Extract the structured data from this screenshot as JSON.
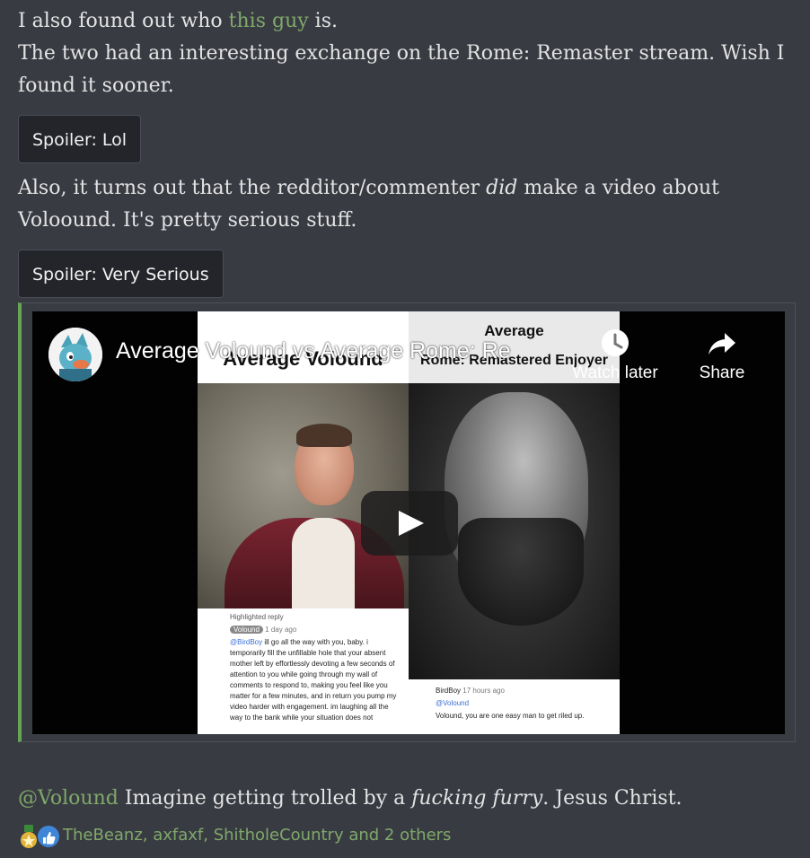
{
  "post": {
    "line1_prefix": "I also found out who ",
    "line1_link": "this guy",
    "line1_suffix": " is.",
    "line2": "The two had an interesting exchange on the Rome: Remaster stream. Wish I found it sooner.",
    "spoiler1_label": "Spoiler: Lol",
    "line3_prefix": "Also, it turns out that the redditor/commenter ",
    "line3_emph": "did",
    "line3_suffix": " make a video about Voloound. It's pretty serious stuff.",
    "spoiler2_label": "Spoiler: Very Serious",
    "mention": "@Volound",
    "closing_prefix": " Imagine getting trolled by a ",
    "closing_emph": "fucking furry",
    "closing_suffix": ". Jesus Christ."
  },
  "video": {
    "title": "Average Volound vs Average Rome: Re",
    "watch_later_label": "Watch later",
    "share_label": "Share",
    "thumbnail": {
      "left_title": "Average Volound",
      "right_title_line1": "Average",
      "right_title_line2": "Rome: Remastered Enjoyer",
      "left_comment_header": "Highlighted reply",
      "left_comment_author": "Volound",
      "left_comment_time": "1 day ago",
      "left_comment_mention": "@BirdBoy",
      "left_comment_text": "ill go all the way with you, baby. i temporarily fill the unfillable hole that your absent mother left by effortlessly devoting a few seconds of attention to you while going through my wall of comments to respond to, making you feel like you matter for a few minutes, and in return you pump my video harder with engagement. im laughing all the way to the bank while your situation does not",
      "right_comment_author": "BirdBoy",
      "right_comment_time": "17 hours ago",
      "right_comment_mention": "@Volound",
      "right_comment_text": "Volound, you are one easy man to get riled up."
    }
  },
  "reactions": {
    "names": "TheBeanz, axfaxf, ShitholeCountry and 2 others"
  },
  "colors": {
    "background": "#393b43",
    "link": "#7fa869",
    "embed_accent": "#67a556"
  }
}
